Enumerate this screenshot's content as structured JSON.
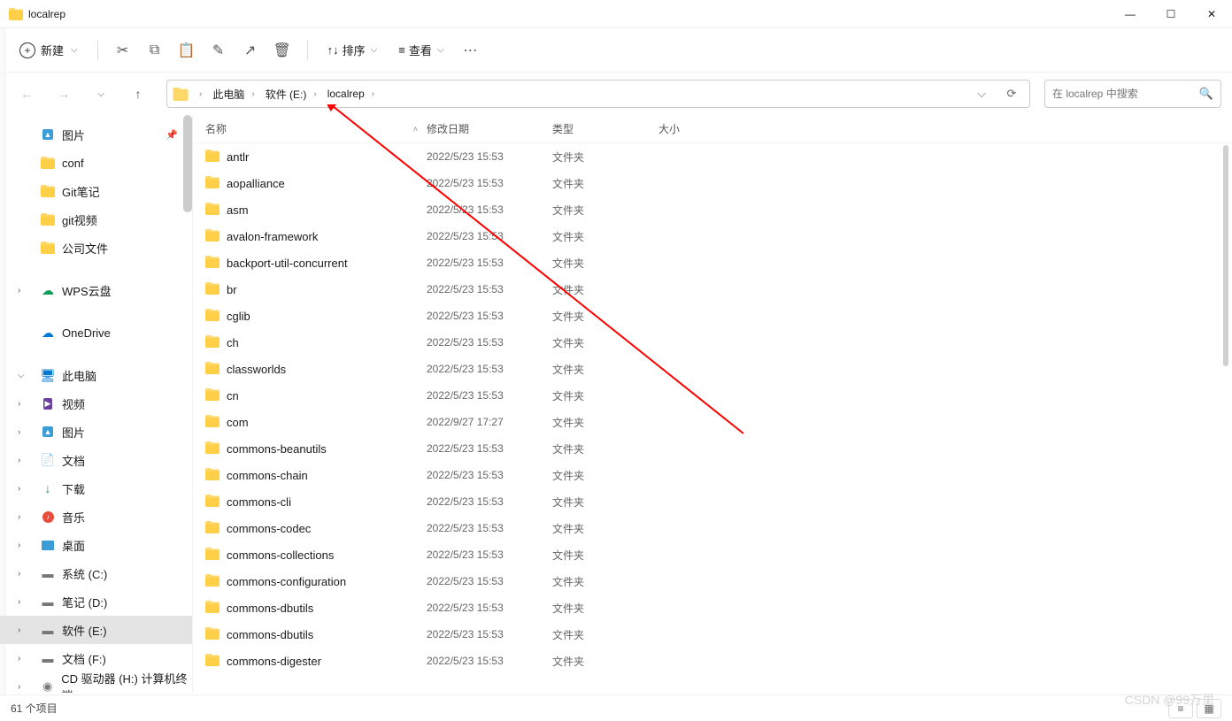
{
  "window": {
    "title": "localrep"
  },
  "toolbar": {
    "new_label": "新建",
    "sort_label": "排序",
    "view_label": "查看"
  },
  "breadcrumb": [
    {
      "label": "此电脑"
    },
    {
      "label": "软件 (E:)"
    },
    {
      "label": "localrep"
    }
  ],
  "search": {
    "placeholder": "在 localrep 中搜索"
  },
  "sidebar": {
    "quick": [
      {
        "label": "图片",
        "pinned": true,
        "icon": "img"
      },
      {
        "label": "conf",
        "icon": "folder"
      },
      {
        "label": "Git笔记",
        "icon": "folder"
      },
      {
        "label": "git视频",
        "icon": "folder"
      },
      {
        "label": "公司文件",
        "icon": "folder"
      }
    ],
    "wps": {
      "label": "WPS云盘"
    },
    "onedrive": {
      "label": "OneDrive"
    },
    "thispc": {
      "label": "此电脑"
    },
    "thispc_items": [
      {
        "label": "视频",
        "icon": "vid"
      },
      {
        "label": "图片",
        "icon": "img"
      },
      {
        "label": "文档",
        "icon": "doc"
      },
      {
        "label": "下载",
        "icon": "dl"
      },
      {
        "label": "音乐",
        "icon": "mus"
      },
      {
        "label": "桌面",
        "icon": "desk"
      },
      {
        "label": "系统 (C:)",
        "icon": "drive"
      },
      {
        "label": "笔记 (D:)",
        "icon": "drive"
      },
      {
        "label": "软件 (E:)",
        "icon": "drive",
        "selected": true
      },
      {
        "label": "文档 (F:)",
        "icon": "drive"
      },
      {
        "label": "CD 驱动器 (H:) 计算机终端",
        "icon": "cd"
      }
    ]
  },
  "columns": {
    "name": "名称",
    "date": "修改日期",
    "type": "类型",
    "size": "大小"
  },
  "files": [
    {
      "name": "antlr",
      "date": "2022/5/23 15:53",
      "type": "文件夹"
    },
    {
      "name": "aopalliance",
      "date": "2022/5/23 15:53",
      "type": "文件夹"
    },
    {
      "name": "asm",
      "date": "2022/5/23 15:53",
      "type": "文件夹"
    },
    {
      "name": "avalon-framework",
      "date": "2022/5/23 15:53",
      "type": "文件夹"
    },
    {
      "name": "backport-util-concurrent",
      "date": "2022/5/23 15:53",
      "type": "文件夹"
    },
    {
      "name": "br",
      "date": "2022/5/23 15:53",
      "type": "文件夹"
    },
    {
      "name": "cglib",
      "date": "2022/5/23 15:53",
      "type": "文件夹"
    },
    {
      "name": "ch",
      "date": "2022/5/23 15:53",
      "type": "文件夹"
    },
    {
      "name": "classworlds",
      "date": "2022/5/23 15:53",
      "type": "文件夹"
    },
    {
      "name": "cn",
      "date": "2022/5/23 15:53",
      "type": "文件夹"
    },
    {
      "name": "com",
      "date": "2022/9/27 17:27",
      "type": "文件夹"
    },
    {
      "name": "commons-beanutils",
      "date": "2022/5/23 15:53",
      "type": "文件夹"
    },
    {
      "name": "commons-chain",
      "date": "2022/5/23 15:53",
      "type": "文件夹"
    },
    {
      "name": "commons-cli",
      "date": "2022/5/23 15:53",
      "type": "文件夹"
    },
    {
      "name": "commons-codec",
      "date": "2022/5/23 15:53",
      "type": "文件夹"
    },
    {
      "name": "commons-collections",
      "date": "2022/5/23 15:53",
      "type": "文件夹"
    },
    {
      "name": "commons-configuration",
      "date": "2022/5/23 15:53",
      "type": "文件夹"
    },
    {
      "name": "commons-dbutils",
      "date": "2022/5/23 15:53",
      "type": "文件夹"
    },
    {
      "name": "commons-dbutils",
      "date": "2022/5/23 15:53",
      "type": "文件夹"
    },
    {
      "name": "commons-digester",
      "date": "2022/5/23 15:53",
      "type": "文件夹"
    }
  ],
  "status": {
    "count": "61 个项目"
  },
  "watermark": "CSDN @99万里"
}
